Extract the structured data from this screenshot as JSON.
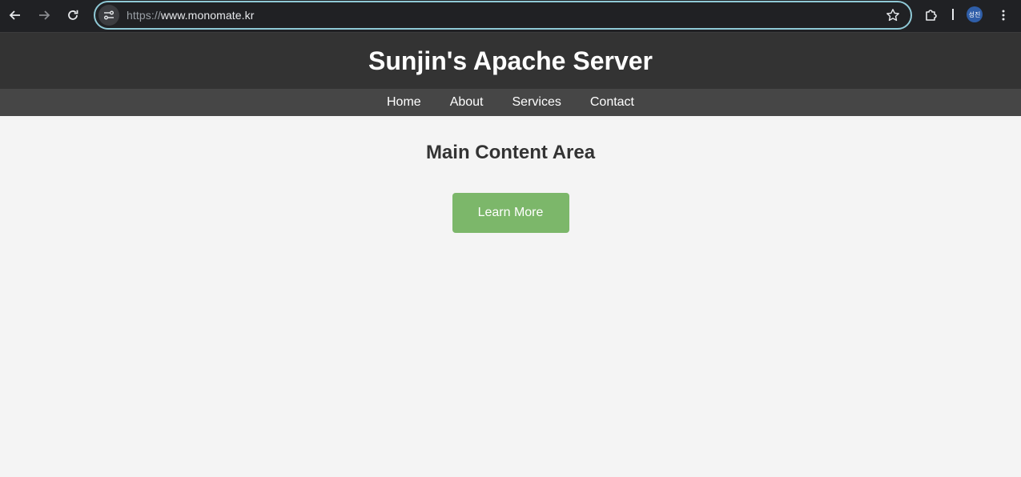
{
  "browser": {
    "url_scheme": "https://",
    "url_host": "www.monomate.kr",
    "profile_initials": "성진",
    "accent_color": "#8fc9d6",
    "icons": [
      "back-arrow-icon",
      "forward-arrow-icon",
      "reload-icon",
      "site-info-icon",
      "bookmark-star-icon",
      "extensions-puzzle-icon",
      "kebab-menu-icon"
    ]
  },
  "header": {
    "title": "Sunjin's Apache Server",
    "background": "#333333"
  },
  "nav": {
    "items": [
      {
        "label": "Home"
      },
      {
        "label": "About"
      },
      {
        "label": "Services"
      },
      {
        "label": "Contact"
      }
    ],
    "background": "#464646"
  },
  "main": {
    "title": "Main Content Area",
    "button_label": "Learn More",
    "button_color": "#7cb76a"
  }
}
